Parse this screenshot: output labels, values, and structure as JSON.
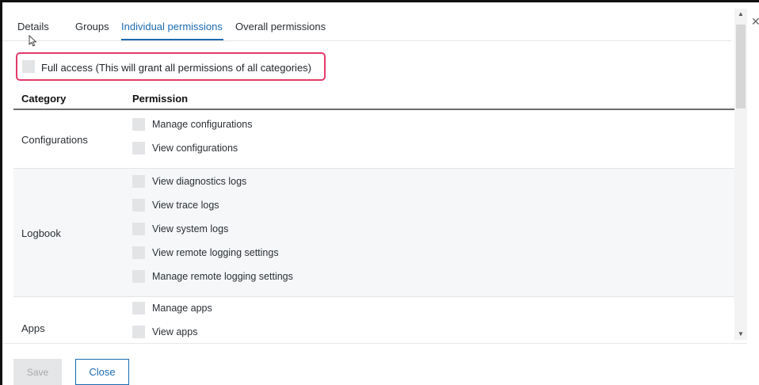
{
  "tabs": [
    {
      "label": "Details"
    },
    {
      "label": "Groups"
    },
    {
      "label": "Individual permissions"
    },
    {
      "label": "Overall permissions"
    }
  ],
  "active_tab": "Individual permissions",
  "full_access": {
    "label": "Full access (This will grant all permissions of all categories)",
    "checked": false
  },
  "table": {
    "headers": {
      "category": "Category",
      "permission": "Permission"
    },
    "rows": [
      {
        "category": "Configurations",
        "permissions": [
          "Manage configurations",
          "View configurations"
        ]
      },
      {
        "category": "Logbook",
        "permissions": [
          "View diagnostics logs",
          "View trace logs",
          "View system logs",
          "View remote logging settings",
          "Manage remote logging settings"
        ]
      },
      {
        "category": "Apps",
        "permissions": [
          "Manage apps",
          "View apps"
        ]
      }
    ]
  },
  "buttons": {
    "save": "Save",
    "close": "Close"
  },
  "colors": {
    "accent": "#1b6bb0",
    "highlight_border": "#e23b6a",
    "disabled": "#a7a9ac"
  }
}
